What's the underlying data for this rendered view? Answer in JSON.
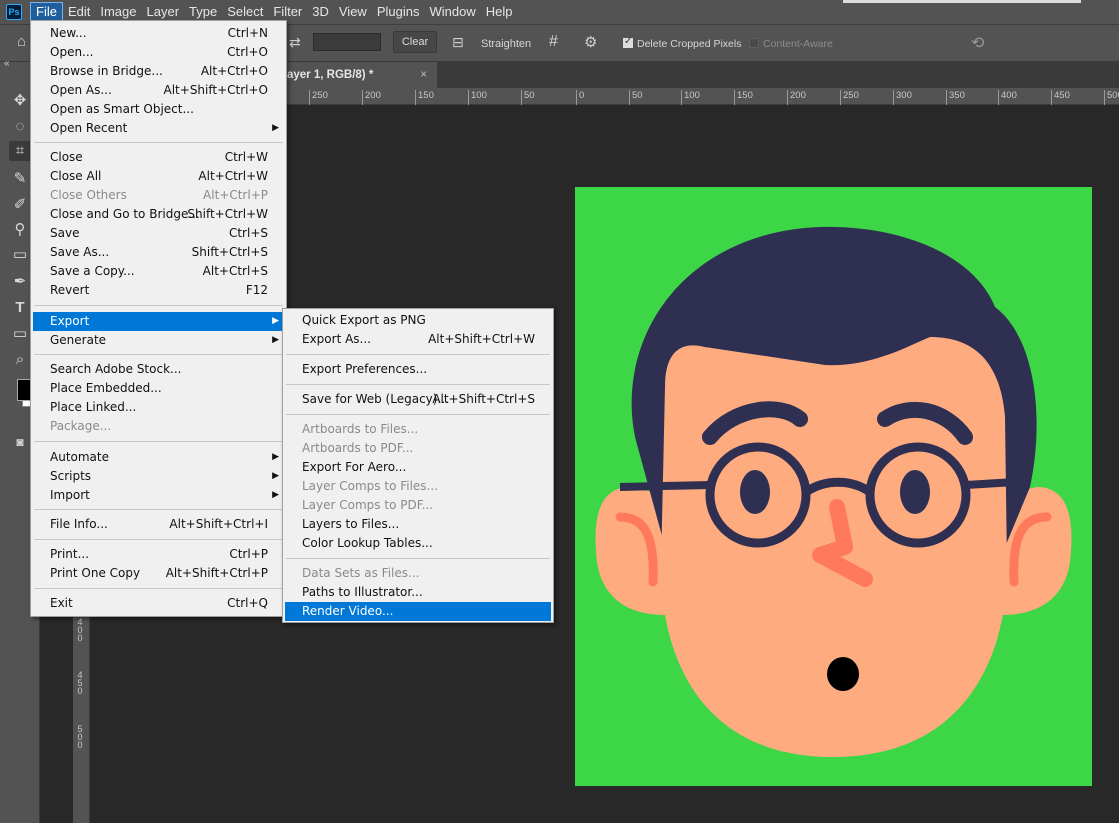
{
  "app": {
    "logo": "Ps",
    "menubar": [
      "File",
      "Edit",
      "Image",
      "Layer",
      "Type",
      "Select",
      "Filter",
      "3D",
      "View",
      "Plugins",
      "Window",
      "Help"
    ],
    "active_menu": "File"
  },
  "options_bar": {
    "clear_label": "Clear",
    "straighten_label": "Straighten",
    "delete_cropped_label": "Delete Cropped Pixels",
    "delete_cropped_checked": true,
    "content_aware_label": "Content-Aware",
    "content_aware_checked": false
  },
  "document_tab": {
    "label": "ayer 1, RGB/8) *",
    "close": "×"
  },
  "ruler": {
    "h_ticks": [
      "250",
      "200",
      "150",
      "100",
      "50",
      "0",
      "50",
      "100",
      "150",
      "200",
      "250",
      "300",
      "350",
      "400",
      "450",
      "500"
    ],
    "v_labels": [
      "4\n0\n0",
      "4\n5\n0",
      "5\n0\n0"
    ]
  },
  "file_menu": {
    "items": [
      {
        "label": "New...",
        "shortcut": "Ctrl+N"
      },
      {
        "label": "Open...",
        "shortcut": "Ctrl+O"
      },
      {
        "label": "Browse in Bridge...",
        "shortcut": "Alt+Ctrl+O"
      },
      {
        "label": "Open As...",
        "shortcut": "Alt+Shift+Ctrl+O"
      },
      {
        "label": "Open as Smart Object...",
        "shortcut": ""
      },
      {
        "label": "Open Recent",
        "shortcut": ""
      },
      {
        "label": "Close",
        "shortcut": "Ctrl+W"
      },
      {
        "label": "Close All",
        "shortcut": "Alt+Ctrl+W"
      },
      {
        "label": "Close Others",
        "shortcut": "Alt+Ctrl+P"
      },
      {
        "label": "Close and Go to Bridge...",
        "shortcut": "Shift+Ctrl+W"
      },
      {
        "label": "Save",
        "shortcut": "Ctrl+S"
      },
      {
        "label": "Save As...",
        "shortcut": "Shift+Ctrl+S"
      },
      {
        "label": "Save a Copy...",
        "shortcut": "Alt+Ctrl+S"
      },
      {
        "label": "Revert",
        "shortcut": "F12"
      },
      {
        "label": "Export",
        "shortcut": ""
      },
      {
        "label": "Generate",
        "shortcut": ""
      },
      {
        "label": "Search Adobe Stock...",
        "shortcut": ""
      },
      {
        "label": "Place Embedded...",
        "shortcut": ""
      },
      {
        "label": "Place Linked...",
        "shortcut": ""
      },
      {
        "label": "Package...",
        "shortcut": ""
      },
      {
        "label": "Automate",
        "shortcut": ""
      },
      {
        "label": "Scripts",
        "shortcut": ""
      },
      {
        "label": "Import",
        "shortcut": ""
      },
      {
        "label": "File Info...",
        "shortcut": "Alt+Shift+Ctrl+I"
      },
      {
        "label": "Print...",
        "shortcut": "Ctrl+P"
      },
      {
        "label": "Print One Copy",
        "shortcut": "Alt+Shift+Ctrl+P"
      },
      {
        "label": "Exit",
        "shortcut": "Ctrl+Q"
      }
    ]
  },
  "export_menu": {
    "items": [
      {
        "label": "Quick Export as PNG",
        "shortcut": ""
      },
      {
        "label": "Export As...",
        "shortcut": "Alt+Shift+Ctrl+W"
      },
      {
        "label": "Export Preferences...",
        "shortcut": ""
      },
      {
        "label": "Save for Web (Legacy)...",
        "shortcut": "Alt+Shift+Ctrl+S"
      },
      {
        "label": "Artboards to Files...",
        "shortcut": ""
      },
      {
        "label": "Artboards to PDF...",
        "shortcut": ""
      },
      {
        "label": "Export For Aero...",
        "shortcut": ""
      },
      {
        "label": "Layer Comps to Files...",
        "shortcut": ""
      },
      {
        "label": "Layer Comps to PDF...",
        "shortcut": ""
      },
      {
        "label": "Layers to Files...",
        "shortcut": ""
      },
      {
        "label": "Color Lookup Tables...",
        "shortcut": ""
      },
      {
        "label": "Data Sets as Files...",
        "shortcut": ""
      },
      {
        "label": "Paths to Illustrator...",
        "shortcut": ""
      },
      {
        "label": "Render Video...",
        "shortcut": ""
      }
    ]
  },
  "icons": {
    "tools": [
      "move-icon",
      "lasso-icon",
      "crop-icon",
      "eyedropper-icon",
      "brush-icon",
      "stamp-icon",
      "gradient-icon",
      "pen-icon",
      "type-icon",
      "rectangle-icon",
      "zoom-icon"
    ]
  },
  "colors": {
    "canvas_green": "#3dd646",
    "hair": "#2f2f52",
    "skin": "#ffab80",
    "highlight": "#0078d7"
  }
}
